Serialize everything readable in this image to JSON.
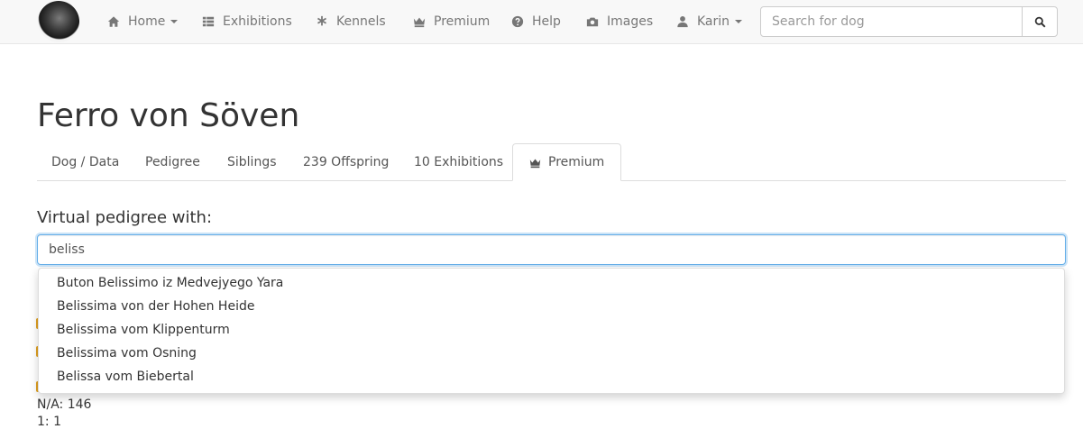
{
  "navbar": {
    "items": [
      {
        "label": "Home",
        "icon": "home-icon",
        "has_caret": true
      },
      {
        "label": "Exhibitions",
        "icon": "grid-icon"
      },
      {
        "label": "Kennels",
        "icon": "asterisk-icon"
      },
      {
        "label": "Premium",
        "icon": "crown-icon"
      },
      {
        "label": "Help",
        "icon": "question-icon"
      },
      {
        "label": "Images",
        "icon": "camera-icon"
      },
      {
        "label": "Karin",
        "icon": "user-icon",
        "has_caret": true
      }
    ],
    "search": {
      "placeholder": "Search for dog",
      "value": ""
    }
  },
  "page": {
    "title": "Ferro von Söven",
    "tabs": [
      {
        "label": "Dog / Data"
      },
      {
        "label": "Pedigree"
      },
      {
        "label": "Siblings"
      },
      {
        "label": "239 Offspring"
      },
      {
        "label": "10 Exhibitions"
      },
      {
        "label": "Premium",
        "active": true,
        "icon": "crown-icon"
      }
    ]
  },
  "virtual_pedigree": {
    "label": "Virtual pedigree with:",
    "input_value": "beliss",
    "suggestions": [
      "Buton Belissimo iz Medvejyego Yara",
      "Belissima von der Hohen Heide",
      "Belissima vom Klippenturm",
      "Belissima vom Osning",
      "Belissa vom Biebertal"
    ]
  },
  "stats": {
    "na_line": "N/A: 146",
    "ratio_line": "1: 1"
  },
  "colors": {
    "accent_focus": "#66afe9",
    "text": "#333333",
    "nav_text": "#777777"
  }
}
